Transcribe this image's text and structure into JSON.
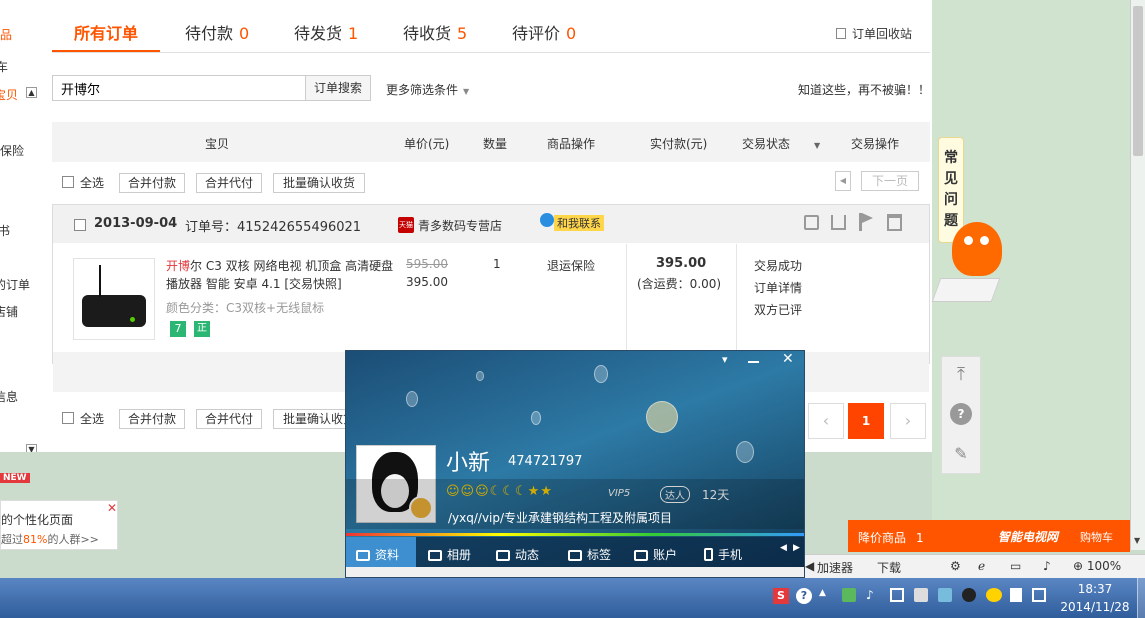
{
  "left_strip": {
    "items": [
      "品",
      "车",
      "宝贝",
      "保险",
      "书",
      "的订单",
      "店铺",
      "信息"
    ],
    "new_badge": "NEW",
    "promo_line1": "的个性化页面",
    "promo_line2_pre": "超过",
    "promo_pct": "81%",
    "promo_line2_post": "的人群>>"
  },
  "tabs": [
    {
      "label": "所有订单",
      "count": ""
    },
    {
      "label": "待付款",
      "count": "0"
    },
    {
      "label": "待发货",
      "count": "1"
    },
    {
      "label": "待收货",
      "count": "5"
    },
    {
      "label": "待评价",
      "count": "0"
    }
  ],
  "recycle_label": "订单回收站",
  "search": {
    "value": "开博尔",
    "button": "订单搜索",
    "more": "更多筛选条件",
    "notice": "知道这些，再不被骗！！"
  },
  "columns": [
    "宝贝",
    "单价(元)",
    "数量",
    "商品操作",
    "实付款(元)",
    "交易状态",
    "交易操作"
  ],
  "bulk": {
    "select_all": "全选",
    "merge_pay": "合并付款",
    "merge_proxy": "合并代付",
    "batch_confirm": "批量确认收货",
    "next_page": "下一页"
  },
  "order": {
    "date": "2013-09-04",
    "order_no_label": "订单号：",
    "order_no": "415242655496021",
    "shop_badge": "天猫",
    "shop": "青多数码专营店",
    "contact": "和我联系",
    "title_highlight": "开博",
    "title_rest": "尔 C3 双核 网络电视 机顶盒 高清硬盘播放器 智能 安卓 4.1 [交易快照]",
    "sku": "颜色分类：C3双核+无线鼠标",
    "badge1": "7",
    "badge2": "正",
    "orig_price": "595.00",
    "price": "395.00",
    "qty": "1",
    "op": "退运保险",
    "paid": "395.00",
    "shipping": "(含运费：0.00)",
    "status": "交易成功",
    "detail": "订单详情",
    "review": "双方已评"
  },
  "pagination": {
    "current": "1"
  },
  "faq": "常见问题",
  "ad": {
    "label": "降价商品",
    "count": "1",
    "brand": "智能电视网",
    "cart": "购物车"
  },
  "qq": {
    "nickname": "小新",
    "number": "474721797",
    "vip": "VIP5",
    "daren": "达人",
    "days": "12天",
    "signature": "/yxq//vip/专业承建钢结构工程及附属项目",
    "tabs": [
      "资料",
      "相册",
      "动态",
      "标签",
      "账户",
      "手机"
    ]
  },
  "statusbar": {
    "accel": "加速器",
    "download": "下载",
    "zoom": "100%"
  },
  "clock": {
    "time": "18:37",
    "date": "2014/11/28"
  },
  "colors": {
    "accent": "#ff5500",
    "tmall": "#c40000"
  }
}
